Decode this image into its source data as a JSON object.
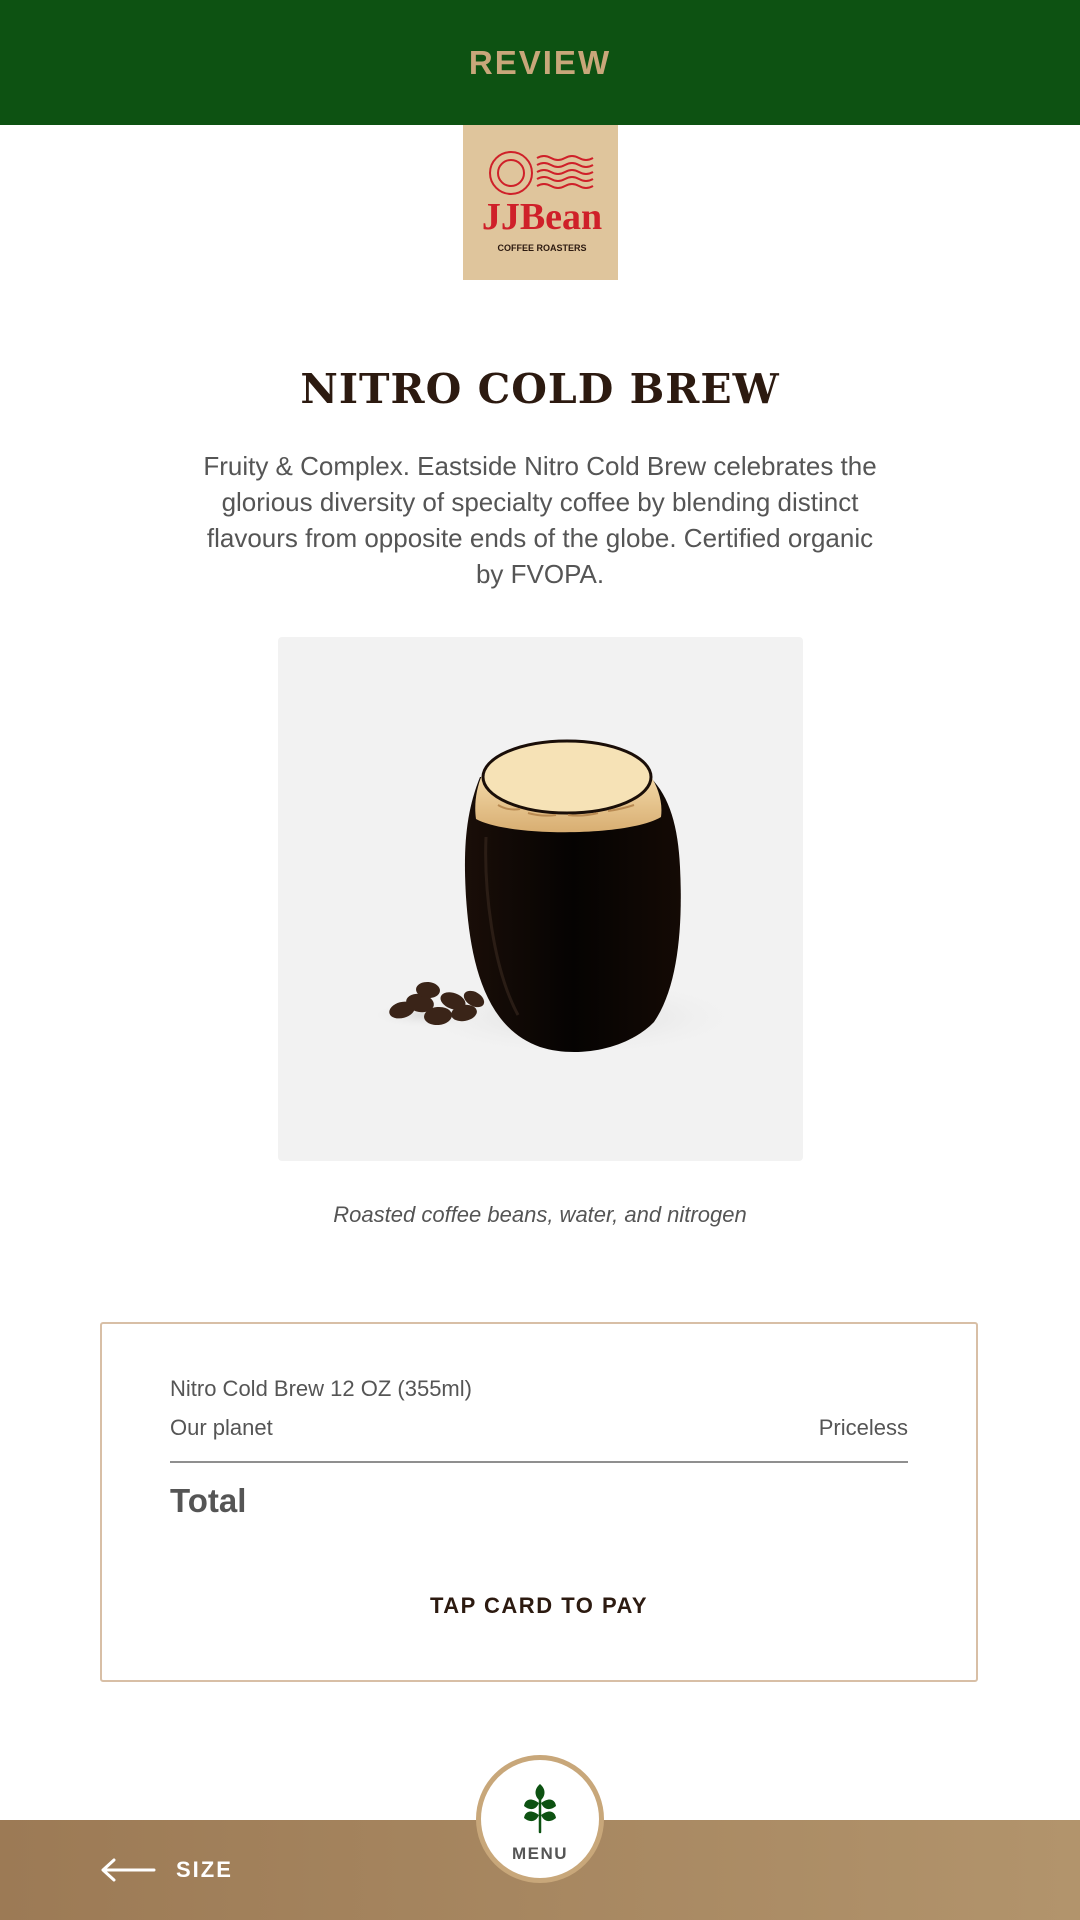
{
  "header": {
    "title": "REVIEW"
  },
  "logo": {
    "brand": "JJBean",
    "tagline": "COFFEE ROASTERS",
    "background": "#dfc59c",
    "ink": "#cf2029"
  },
  "product": {
    "name": "NITRO COLD BREW",
    "description": "Fruity & Complex. Eastside Nitro Cold Brew celebrates the glorious diversity of specialty coffee by blending distinct flavours from opposite ends of the globe. Certified organic by FVOPA.",
    "ingredients": "Roasted coffee beans, water, and nitrogen"
  },
  "order": {
    "item": "Nitro Cold Brew 12 OZ (355ml)",
    "sub_left": "Our planet",
    "sub_right": "Priceless",
    "total_label": "Total",
    "pay_label": "TAP CARD TO PAY"
  },
  "footer": {
    "back_label": "SIZE",
    "back_icon": "arrow-left-icon",
    "menu_label": "MENU",
    "menu_icon": "leaf-icon"
  },
  "colors": {
    "header_bg": "#0d5212",
    "accent": "#c8a77a",
    "footer_bg": "#a98b63",
    "title_text": "#2c1a10",
    "body_text": "#555555"
  }
}
